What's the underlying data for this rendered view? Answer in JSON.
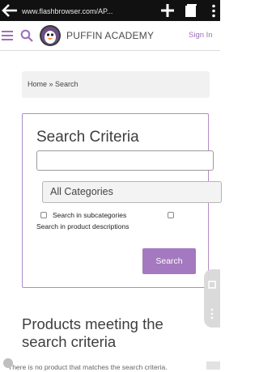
{
  "browser": {
    "url": "www.flashbrowser.com/AP...",
    "icons": [
      "back-arrow-icon",
      "new-tab-plus-icon",
      "tabs-icon",
      "overflow-menu-icon"
    ]
  },
  "header": {
    "brand": "PUFFIN ACADEMY",
    "signin": "Sign In",
    "icons": [
      "hamburger-menu-icon",
      "search-icon",
      "puffin-logo-icon"
    ],
    "accent_color": "#9e6fb8"
  },
  "breadcrumb": {
    "text": "Home » Search"
  },
  "criteria": {
    "title": "Search Criteria",
    "keyword_value": "",
    "category_selected": "All Categories",
    "subcategories_label": "Search in subcategories",
    "subcategories_checked": false,
    "descriptions_label": "Search in product descriptions",
    "descriptions_checked": false,
    "search_button": "Search",
    "button_color": "#a479bf",
    "border_color": "#b08cc6"
  },
  "results": {
    "heading": "Products meeting the search criteria",
    "note": "There is no product that matches the search criteria."
  }
}
